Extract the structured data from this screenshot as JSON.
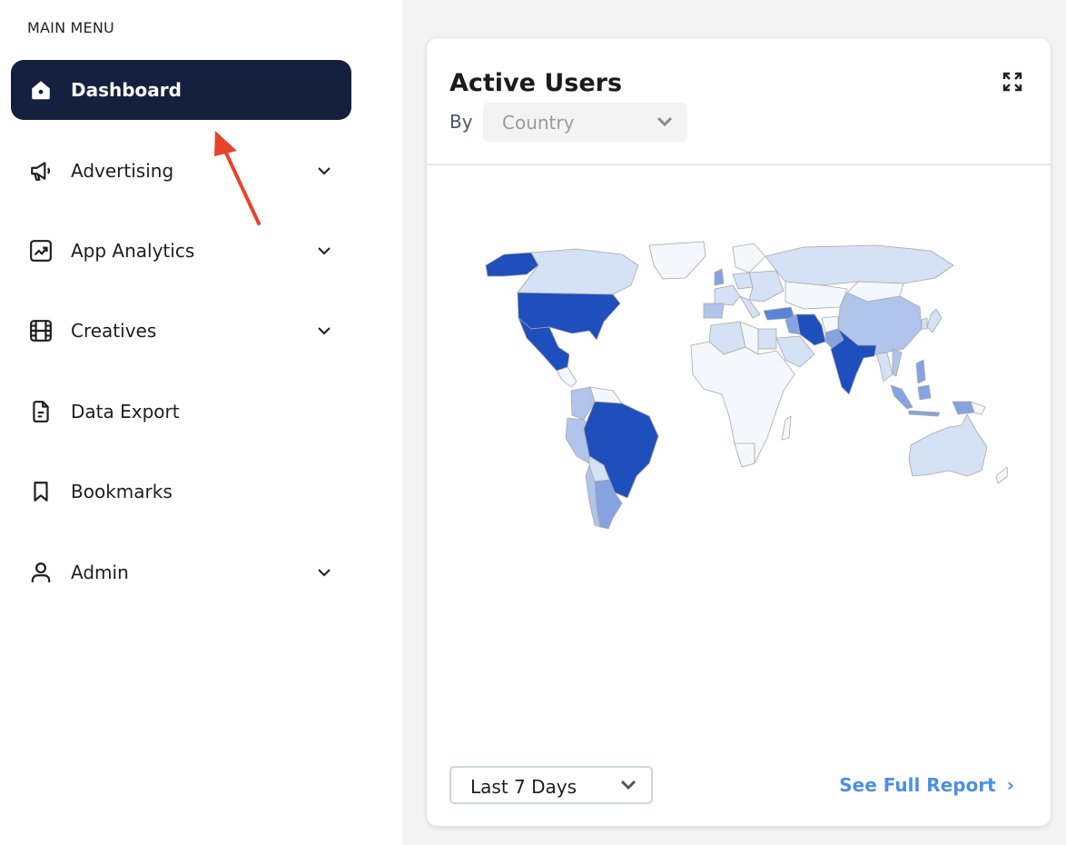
{
  "sidebar": {
    "heading": "MAIN MENU",
    "items": [
      {
        "label": "Dashboard",
        "icon": "home-icon",
        "active": true,
        "expandable": false
      },
      {
        "label": "Advertising",
        "icon": "megaphone-icon",
        "active": false,
        "expandable": true
      },
      {
        "label": "App Analytics",
        "icon": "chart-trend-icon",
        "active": false,
        "expandable": true
      },
      {
        "label": "Creatives",
        "icon": "film-icon",
        "active": false,
        "expandable": true
      },
      {
        "label": "Data Export",
        "icon": "document-icon",
        "active": false,
        "expandable": false
      },
      {
        "label": "Bookmarks",
        "icon": "bookmark-icon",
        "active": false,
        "expandable": false
      },
      {
        "label": "Admin",
        "icon": "user-icon",
        "active": false,
        "expandable": true
      }
    ]
  },
  "colors": {
    "active_bg": "#15203f",
    "link": "#4a90e2",
    "annotation_arrow": "#e8432c",
    "map_scale": [
      "#f4f8fe",
      "#d5e1f4",
      "#b0c4ec",
      "#86a3e0",
      "#5c84d6",
      "#1f4fbd"
    ]
  },
  "card": {
    "title": "Active Users",
    "by_label": "By",
    "dimension_select": {
      "value": "Country"
    },
    "range_select": {
      "value": "Last 7 Days"
    },
    "report_link": "See Full Report",
    "report_link_icon": "›"
  },
  "map": {
    "metric": "Active Users",
    "dimension": "Country",
    "highest": [
      "United States",
      "Mexico",
      "Brazil",
      "India",
      "Iran",
      "Alaska (US)"
    ],
    "high": [
      "Turkey"
    ],
    "medium": [
      "Argentina",
      "Peru",
      "Indonesia",
      "Pakistan",
      "Iraq",
      "Philippines"
    ],
    "medium_low": [
      "China",
      "Colombia",
      "United Kingdom",
      "Germany",
      "Spain",
      "Vietnam"
    ],
    "low": [
      "Canada",
      "Russia",
      "Australia",
      "Saudi Arabia",
      "Egypt",
      "Kazakhstan",
      "Bolivia",
      "Algeria",
      "Thailand"
    ]
  }
}
